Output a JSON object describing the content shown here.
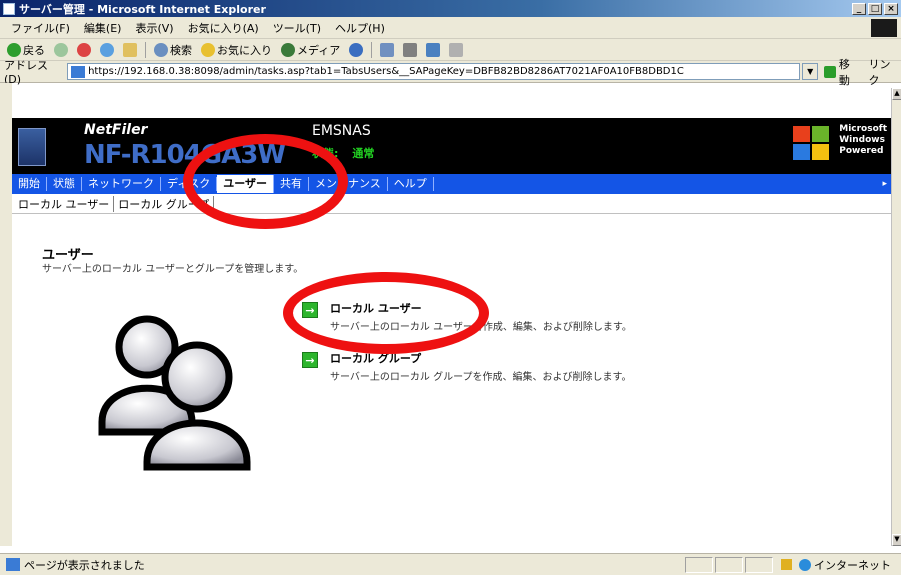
{
  "window": {
    "title": "サーバー管理 - Microsoft Internet Explorer",
    "controls": [
      "_",
      "□",
      "×"
    ]
  },
  "menu": [
    "ファイル(F)",
    "編集(E)",
    "表示(V)",
    "お気に入り(A)",
    "ツール(T)",
    "ヘルプ(H)"
  ],
  "toolbar": {
    "back": "戻る",
    "search": "検索",
    "favorites": "お気に入り",
    "media": "メディア"
  },
  "address": {
    "label": "アドレス(D)",
    "url": "https://192.168.0.38:8098/admin/tasks.asp?tab1=TabsUsers&__SAPageKey=DBFB82BD8286AT7021AF0A10FB8DBD1C",
    "go": "移動",
    "links": "リンク"
  },
  "banner": {
    "brand": "NetFiler",
    "model": "NF-R104GA3W",
    "server_name": "EMSNAS",
    "status_label": "状態:",
    "status_value": "通常",
    "powered": [
      "Microsoft",
      "Windows",
      "Powered"
    ],
    "colors": {
      "model": "#3f6dc7",
      "status": "#22d022",
      "nav": "#1455e6"
    }
  },
  "nav": {
    "items": [
      "開始",
      "状態",
      "ネットワーク",
      "ディスク",
      "ユーザー",
      "共有",
      "メンテナンス",
      "ヘルプ"
    ],
    "active_index": 4
  },
  "subnav": [
    "ローカル ユーザー",
    "ローカル グループ"
  ],
  "page": {
    "heading": "ユーザー",
    "description": "サーバー上のローカル ユーザーとグループを管理します。"
  },
  "tasks": [
    {
      "title": "ローカル ユーザー",
      "description": "サーバー上のローカル ユーザーを作成、編集、および削除します。",
      "icon": "green-arrow-icon"
    },
    {
      "title": "ローカル グループ",
      "description": "サーバー上のローカル グループを作成、編集、および削除します。",
      "icon": "green-arrow-icon"
    }
  ],
  "status_bar": {
    "text": "ページが表示されました",
    "zone": "インターネット"
  },
  "annotations": {
    "callout_color": "#ee1111"
  }
}
